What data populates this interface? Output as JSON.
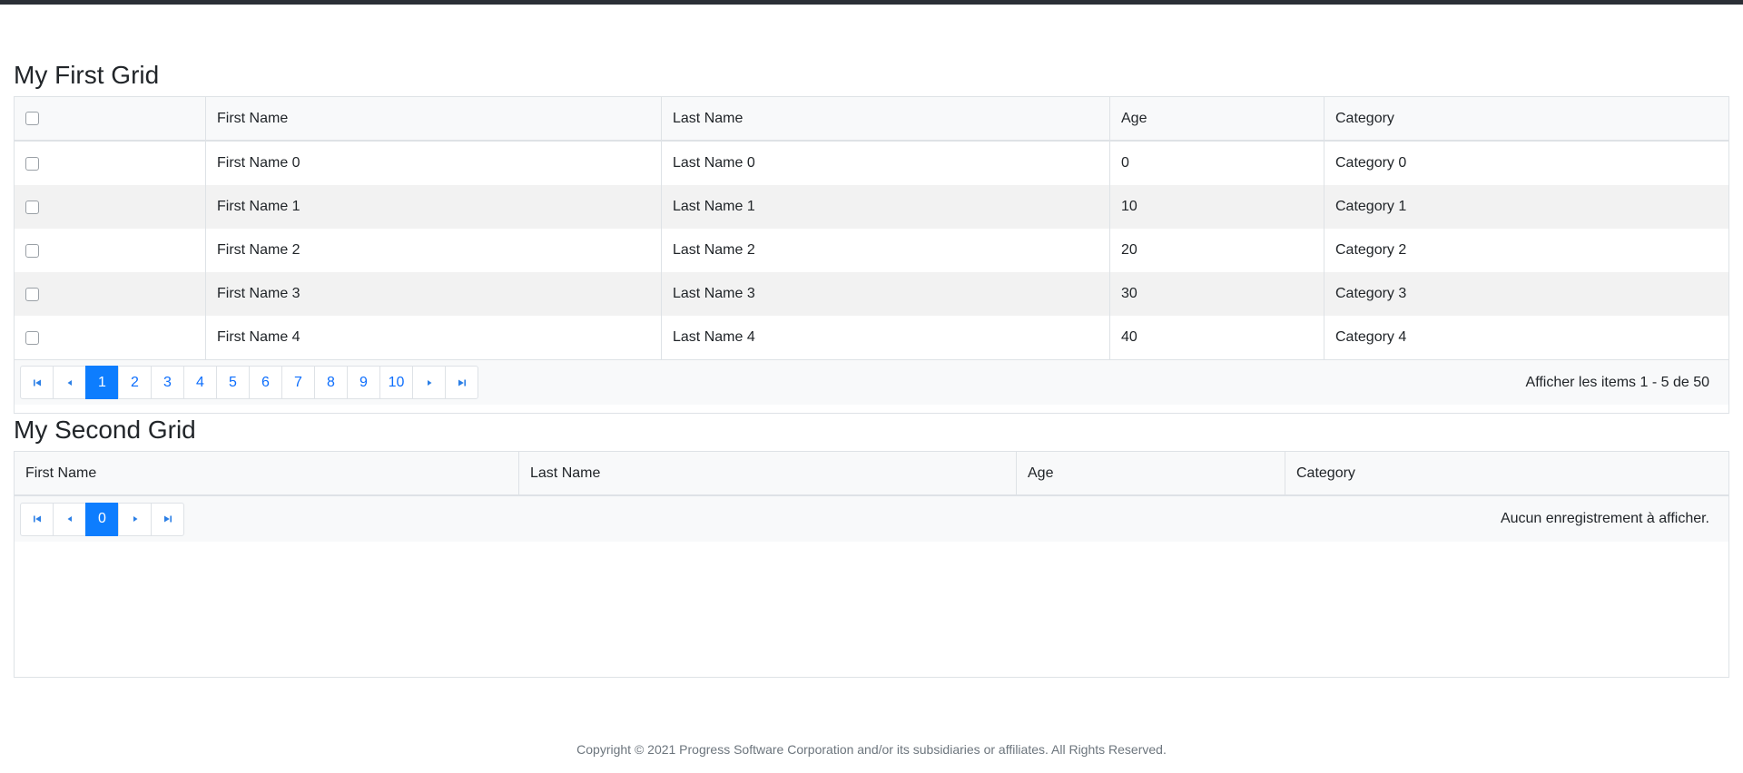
{
  "grid1": {
    "title": "My First Grid",
    "columns": [
      "First Name",
      "Last Name",
      "Age",
      "Category"
    ],
    "rows": [
      {
        "first": "First Name 0",
        "last": "Last Name 0",
        "age": "0",
        "category": "Category 0"
      },
      {
        "first": "First Name 1",
        "last": "Last Name 1",
        "age": "10",
        "category": "Category 1"
      },
      {
        "first": "First Name 2",
        "last": "Last Name 2",
        "age": "20",
        "category": "Category 2"
      },
      {
        "first": "First Name 3",
        "last": "Last Name 3",
        "age": "30",
        "category": "Category 3"
      },
      {
        "first": "First Name 4",
        "last": "Last Name 4",
        "age": "40",
        "category": "Category 4"
      }
    ],
    "pages": [
      "1",
      "2",
      "3",
      "4",
      "5",
      "6",
      "7",
      "8",
      "9",
      "10"
    ],
    "current_page": "1",
    "pager_info": "Afficher les items 1 - 5 de 50"
  },
  "grid2": {
    "title": "My Second Grid",
    "columns": [
      "First Name",
      "Last Name",
      "Age",
      "Category"
    ],
    "current_page": "0",
    "pager_info": "Aucun enregistrement à afficher."
  },
  "footer": {
    "copyright": "Copyright © 2021 Progress Software Corporation and/or its subsidiaries or affiliates. All Rights Reserved."
  },
  "colors": {
    "accent": "#0d7dfe",
    "header_bg": "#f8f9fa",
    "alt_row_bg": "#f2f2f2"
  }
}
